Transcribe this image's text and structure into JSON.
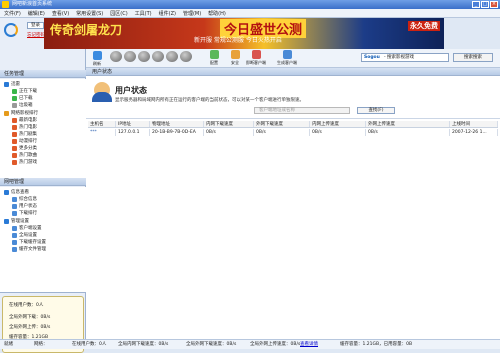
{
  "window": {
    "title": "网吧新浪首页系统"
  },
  "menu": [
    "文件(F)",
    "编辑(E)",
    "查看(V)",
    "常用设置(S)",
    "园区(C)",
    "工具(T)",
    "组件(Z)",
    "管理(M)",
    "帮助(H)"
  ],
  "login": {
    "login_label": "登录",
    "register_label": "注册",
    "forgot_label": "忘记密码"
  },
  "banner": {
    "text1": "传奇剑屠龙刀",
    "text2": "今日盛世公测",
    "text3": "新开服 常规公测服 今日火热开启",
    "text4": "永久免费"
  },
  "toolbar": {
    "refresh_label": "刷新",
    "items": [
      "配置",
      "安全",
      "即断客户端",
      "生成客户端"
    ],
    "search_brand": "Sogou",
    "search_value": "- 搜索影视游戏",
    "search_button": "搜索搜索"
  },
  "left": {
    "task_header": "任务管理",
    "task_tree": [
      "迅雷",
      "正在下载",
      "已下载",
      "垃圾箱",
      "网络影视排行",
      "最新电影",
      "热门电影",
      "热门剧集",
      "动漫排行",
      "更多分类",
      "热门歌曲",
      "热门游戏"
    ],
    "network_header": "网吧管理",
    "network_tree": [
      "信息查看",
      "综合信息",
      "用户状态",
      "下载排行",
      "管理设置",
      "客户端设置",
      "全局设置",
      "下载缓存设置",
      "缓存文件管理"
    ],
    "stats": {
      "online_users": "在线用户数：0人",
      "total_down": "全局外网下载：0B/s",
      "total_up": "全局外网上传：0B/s",
      "cache_size": "缓存容量：1.21GB",
      "used": "已用容量：0B"
    }
  },
  "user_panel": {
    "header": "用户状态",
    "title": "用户状态",
    "desc": "显示服务器和局域网内所有正在运行的客户端的当前状态，可以对某一个客户端进行单独限速。",
    "filter_placeholder": "客户端地址或名称",
    "search_label": "查找(F)",
    "columns": [
      "主机名",
      "IP地址",
      "物理地址",
      "内网下载速度",
      "外网下载速度",
      "内网上传速度",
      "外网上传速度",
      "上线时间"
    ],
    "rows": [
      [
        "***",
        "127.0.0.1",
        "20-1B-B9-7B-0D-EA",
        "0B/s",
        "0B/s",
        "0B/s",
        "0B/s",
        "2007-12-26 1..."
      ]
    ]
  },
  "status": {
    "label": "就绪",
    "net": "网络：",
    "users": "在线用户数：0人",
    "in_down": "全局内网下载速度：0B/s",
    "out_down": "全局外网下载速度：0B/s",
    "out_up": "全局外网上传速度：0B/s",
    "details": "查看详情",
    "cache": "缓存容量：1.21GB，已用容量：0B"
  }
}
